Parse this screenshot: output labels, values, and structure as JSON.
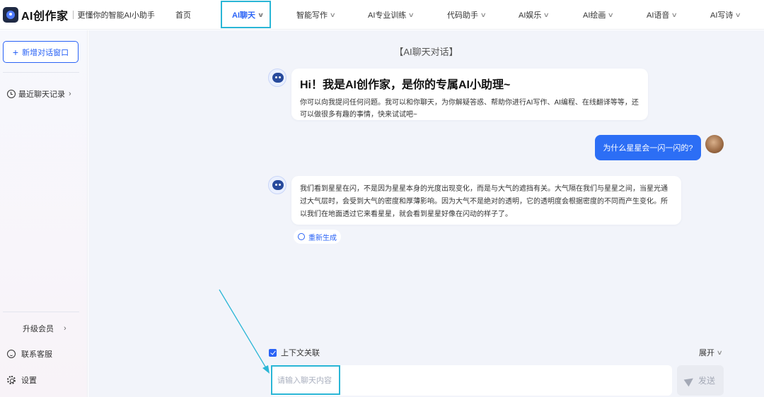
{
  "header": {
    "logo_text": "AI创作家",
    "slogan": "更懂你的智能AI小助手",
    "nav": [
      {
        "label": "首页",
        "has_dropdown": false,
        "active": false
      },
      {
        "label": "AI聊天",
        "has_dropdown": true,
        "active": true
      },
      {
        "label": "智能写作",
        "has_dropdown": true,
        "active": false
      },
      {
        "label": "AI专业训练",
        "has_dropdown": true,
        "active": false
      },
      {
        "label": "代码助手",
        "has_dropdown": true,
        "active": false
      },
      {
        "label": "AI娱乐",
        "has_dropdown": true,
        "active": false
      },
      {
        "label": "AI绘画",
        "has_dropdown": true,
        "active": false
      },
      {
        "label": "AI语音",
        "has_dropdown": true,
        "active": false
      },
      {
        "label": "AI写诗",
        "has_dropdown": true,
        "active": false
      }
    ]
  },
  "sidebar": {
    "new_chat_label": "新增对话窗口",
    "recent_label": "最近聊天记录",
    "upgrade_label": "升级会员",
    "support_label": "联系客服",
    "settings_label": "设置"
  },
  "chat": {
    "title": "【AI聊天对话】",
    "greeting": {
      "title": "Hi！我是AI创作家，是你的专属AI小助理~",
      "body": "你可以向我提问任何问题。我可以和你聊天，为你解疑答惑、帮助你进行AI写作、AI编程、在线翻译等等，还可以做很多有趣的事情，快来试试吧~"
    },
    "user_message": "为什么星星会一闪一闪的?",
    "bot_answer": "我们看到星星在闪，不是因为星星本身的光度出现变化，而是与大气的遮挡有关。大气隔在我们与星星之间，当星光通过大气层时，会受到大气的密度和厚薄影响。因为大气不是绝对的透明，它的透明度会根据密度的不同而产生变化。所以我们在地面透过它来看星星，就会看到星星好像在闪动的样子了。",
    "regenerate_label": "重新生成"
  },
  "composer": {
    "context_label": "上下文关联",
    "context_checked": true,
    "expand_label": "展开",
    "input_placeholder": "请输入聊天内容",
    "input_value": "",
    "send_label": "发送"
  },
  "colors": {
    "accent": "#2a63f6",
    "user_bubble": "#2c6ef5",
    "highlight_box": "#2ab6d6",
    "main_bg": "#f2f4fa"
  }
}
